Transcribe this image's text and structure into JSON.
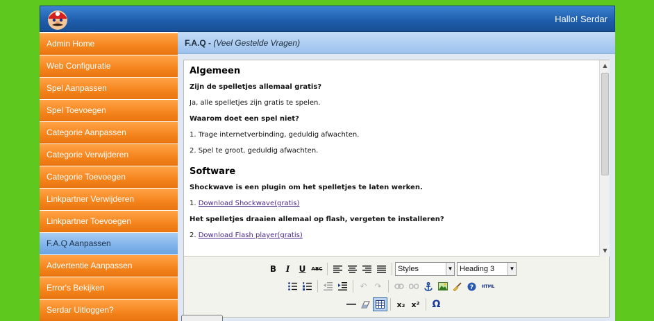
{
  "header": {
    "greeting": "Hallo! Serdar",
    "logo_icon": "mario-logo-icon"
  },
  "sidebar": {
    "items": [
      {
        "label": "Admin Home",
        "active": false
      },
      {
        "label": "Web Configuratie",
        "active": false
      },
      {
        "label": "Spel Aanpassen",
        "active": false
      },
      {
        "label": "Spel Toevoegen",
        "active": false
      },
      {
        "label": "Categorie Aanpassen",
        "active": false
      },
      {
        "label": "Categorie Verwijderen",
        "active": false
      },
      {
        "label": "Categorie Toevoegen",
        "active": false
      },
      {
        "label": "Linkpartner Verwijderen",
        "active": false
      },
      {
        "label": "Linkpartner Toevoegen",
        "active": false
      },
      {
        "label": "F.A.Q Aanpassen",
        "active": true
      },
      {
        "label": "Advertentie Aanpassen",
        "active": false
      },
      {
        "label": "Error's Bekijken",
        "active": false
      },
      {
        "label": "Serdar Uitloggen?",
        "active": false
      }
    ]
  },
  "main": {
    "title": "F.A.Q -",
    "subtitle": "(Veel Gestelde Vragen)"
  },
  "editor": {
    "content": {
      "heading1": "Algemeen",
      "q1": "Zijn de spelletjes allemaal gratis?",
      "a1": "Ja, alle spelletjes zijn gratis te spelen.",
      "q2": "Waarom doet een spel niet?",
      "a2_1": "1. Trage internetverbinding, geduldig afwachten.",
      "a2_2": "2. Spel te groot, geduldig afwachten.",
      "heading2": "Software",
      "q3": "Shockwave is een plugin om het spelletjes te laten werken.",
      "a3_prefix": "1. ",
      "a3_link": "Download Shockwave(gratis)",
      "q4": "Het spelletjes draaien allemaal op flash, vergeten te installeren?",
      "a4_prefix": "2. ",
      "a4_link": "Download Flash player(gratis)"
    },
    "toolbar": {
      "bold": "B",
      "italic": "I",
      "underline": "U",
      "strike": "ABC",
      "styles_value": "Styles",
      "format_value": "Heading 3",
      "html": "HTML",
      "subscript": "x₂",
      "superscript": "x²",
      "omega": "Ω"
    }
  },
  "colors": {
    "background": "#5fc81e",
    "header": "#1f5fae",
    "nav_orange": "#f5841c",
    "nav_active": "#7eb2ea"
  }
}
